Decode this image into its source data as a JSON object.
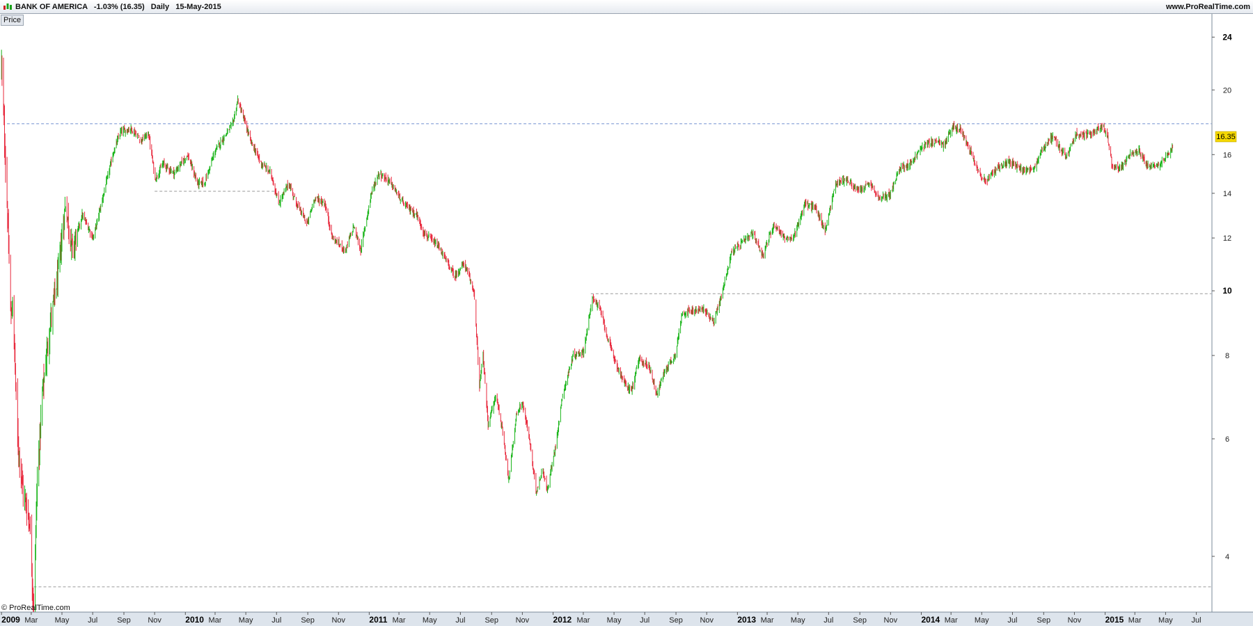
{
  "header": {
    "instrument": "BANK OF AMERICA",
    "change": "-1.03% (16.35)",
    "period": "Daily",
    "date": "15-May-2015",
    "website": "www.ProRealTime.com"
  },
  "panel_label": "Price",
  "copyright": "© ProRealTime.com",
  "chart_data": {
    "type": "candlestick",
    "scale": "log",
    "ylim": [
      3.3,
      26
    ],
    "xlim": [
      "2008-12-29",
      "2015-08-01"
    ],
    "last_price": 16.35,
    "last_price_label": "16.35",
    "colors": {
      "up": "#18b418",
      "down": "#e8283c",
      "last_price_bg": "#f5d800",
      "resistance": "#6f8fcf",
      "support": "#9a9a9a"
    },
    "y_ticks": [
      {
        "value": 24,
        "label": "24",
        "bold": true
      },
      {
        "value": 20,
        "label": "20",
        "bold": false
      },
      {
        "value": 16,
        "label": "16",
        "bold": false
      },
      {
        "value": 14,
        "label": "14",
        "bold": false
      },
      {
        "value": 12,
        "label": "12",
        "bold": false
      },
      {
        "value": 10,
        "label": "10",
        "bold": true
      },
      {
        "value": 8,
        "label": "8",
        "bold": false
      },
      {
        "value": 6,
        "label": "6",
        "bold": false
      },
      {
        "value": 4,
        "label": "4",
        "bold": false
      }
    ],
    "x_ticks": [
      {
        "date": "2009-01-01",
        "label": "2009",
        "year": true
      },
      {
        "date": "2009-03-01",
        "label": "Mar",
        "year": false
      },
      {
        "date": "2009-05-01",
        "label": "May",
        "year": false
      },
      {
        "date": "2009-07-01",
        "label": "Jul",
        "year": false
      },
      {
        "date": "2009-09-01",
        "label": "Sep",
        "year": false
      },
      {
        "date": "2009-11-01",
        "label": "Nov",
        "year": false
      },
      {
        "date": "2010-01-01",
        "label": "2010",
        "year": true
      },
      {
        "date": "2010-03-01",
        "label": "Mar",
        "year": false
      },
      {
        "date": "2010-05-01",
        "label": "May",
        "year": false
      },
      {
        "date": "2010-07-01",
        "label": "Jul",
        "year": false
      },
      {
        "date": "2010-09-01",
        "label": "Sep",
        "year": false
      },
      {
        "date": "2010-11-01",
        "label": "Nov",
        "year": false
      },
      {
        "date": "2011-01-01",
        "label": "2011",
        "year": true
      },
      {
        "date": "2011-03-01",
        "label": "Mar",
        "year": false
      },
      {
        "date": "2011-05-01",
        "label": "May",
        "year": false
      },
      {
        "date": "2011-07-01",
        "label": "Jul",
        "year": false
      },
      {
        "date": "2011-09-01",
        "label": "Sep",
        "year": false
      },
      {
        "date": "2011-11-01",
        "label": "Nov",
        "year": false
      },
      {
        "date": "2012-01-01",
        "label": "2012",
        "year": true
      },
      {
        "date": "2012-03-01",
        "label": "Mar",
        "year": false
      },
      {
        "date": "2012-05-01",
        "label": "May",
        "year": false
      },
      {
        "date": "2012-07-01",
        "label": "Jul",
        "year": false
      },
      {
        "date": "2012-09-01",
        "label": "Sep",
        "year": false
      },
      {
        "date": "2012-11-01",
        "label": "Nov",
        "year": false
      },
      {
        "date": "2013-01-01",
        "label": "2013",
        "year": true
      },
      {
        "date": "2013-03-01",
        "label": "Mar",
        "year": false
      },
      {
        "date": "2013-05-01",
        "label": "May",
        "year": false
      },
      {
        "date": "2013-07-01",
        "label": "Jul",
        "year": false
      },
      {
        "date": "2013-09-01",
        "label": "Sep",
        "year": false
      },
      {
        "date": "2013-11-01",
        "label": "Nov",
        "year": false
      },
      {
        "date": "2014-01-01",
        "label": "2014",
        "year": true
      },
      {
        "date": "2014-03-01",
        "label": "Mar",
        "year": false
      },
      {
        "date": "2014-05-01",
        "label": "May",
        "year": false
      },
      {
        "date": "2014-07-01",
        "label": "Jul",
        "year": false
      },
      {
        "date": "2014-09-01",
        "label": "Sep",
        "year": false
      },
      {
        "date": "2014-11-01",
        "label": "Nov",
        "year": false
      },
      {
        "date": "2015-01-01",
        "label": "2015",
        "year": true
      },
      {
        "date": "2015-03-01",
        "label": "Mar",
        "year": false
      },
      {
        "date": "2015-05-01",
        "label": "May",
        "year": false
      },
      {
        "date": "2015-07-01",
        "label": "Jul",
        "year": false
      }
    ],
    "hlines": [
      {
        "value": 17.8,
        "from": "2009-01-12",
        "to": "2015-07-31",
        "color": "#6f8fcf"
      },
      {
        "value": 14.1,
        "from": "2009-11-01",
        "to": "2010-07-01",
        "color": "#9a9a9a"
      },
      {
        "value": 9.9,
        "from": "2012-03-16",
        "to": "2015-07-31",
        "color": "#9a9a9a"
      },
      {
        "value": 3.6,
        "from": "2009-03-06",
        "to": "2015-07-31",
        "color": "#9a9a9a"
      }
    ],
    "series": [
      {
        "name": "BANK OF AMERICA",
        "close_path": [
          [
            "2009-01-01",
            22.0
          ],
          [
            "2009-01-12",
            13.5
          ],
          [
            "2009-01-20",
            9.0
          ],
          [
            "2009-01-23",
            9.7
          ],
          [
            "2009-02-02",
            6.0
          ],
          [
            "2009-02-13",
            5.0
          ],
          [
            "2009-02-26",
            4.5
          ],
          [
            "2009-03-06",
            3.3
          ],
          [
            "2009-03-12",
            5.0
          ],
          [
            "2009-03-23",
            7.0
          ],
          [
            "2009-04-08",
            9.0
          ],
          [
            "2009-04-23",
            10.5
          ],
          [
            "2009-05-08",
            13.5
          ],
          [
            "2009-05-22",
            11.5
          ],
          [
            "2009-06-10",
            13.0
          ],
          [
            "2009-07-02",
            12.0
          ],
          [
            "2009-07-23",
            14.0
          ],
          [
            "2009-08-10",
            16.0
          ],
          [
            "2009-08-25",
            17.3
          ],
          [
            "2009-09-15",
            17.5
          ],
          [
            "2009-10-05",
            16.8
          ],
          [
            "2009-10-20",
            17.2
          ],
          [
            "2009-11-02",
            14.7
          ],
          [
            "2009-11-18",
            15.5
          ],
          [
            "2009-12-10",
            15.0
          ],
          [
            "2010-01-05",
            16.0
          ],
          [
            "2010-01-25",
            14.5
          ],
          [
            "2010-02-08",
            14.5
          ],
          [
            "2010-03-01",
            16.2
          ],
          [
            "2010-04-05",
            17.8
          ],
          [
            "2010-04-15",
            19.3
          ],
          [
            "2010-04-30",
            17.8
          ],
          [
            "2010-05-10",
            16.8
          ],
          [
            "2010-06-01",
            15.5
          ],
          [
            "2010-06-20",
            15.0
          ],
          [
            "2010-07-05",
            13.5
          ],
          [
            "2010-07-25",
            14.5
          ],
          [
            "2010-08-10",
            13.5
          ],
          [
            "2010-08-31",
            12.6
          ],
          [
            "2010-09-15",
            13.8
          ],
          [
            "2010-10-05",
            13.5
          ],
          [
            "2010-10-20",
            12.0
          ],
          [
            "2010-11-15",
            11.5
          ],
          [
            "2010-12-01",
            12.5
          ],
          [
            "2010-12-15",
            11.5
          ],
          [
            "2011-01-05",
            14.0
          ],
          [
            "2011-01-20",
            15.0
          ],
          [
            "2011-02-10",
            14.6
          ],
          [
            "2011-03-10",
            13.5
          ],
          [
            "2011-04-05",
            13.0
          ],
          [
            "2011-04-20",
            12.2
          ],
          [
            "2011-05-20",
            11.6
          ],
          [
            "2011-06-20",
            10.5
          ],
          [
            "2011-07-08",
            11.0
          ],
          [
            "2011-07-28",
            10.0
          ],
          [
            "2011-08-08",
            7.2
          ],
          [
            "2011-08-15",
            8.0
          ],
          [
            "2011-08-25",
            6.3
          ],
          [
            "2011-09-10",
            7.0
          ],
          [
            "2011-09-25",
            6.0
          ],
          [
            "2011-10-05",
            5.2
          ],
          [
            "2011-10-20",
            6.5
          ],
          [
            "2011-11-01",
            6.8
          ],
          [
            "2011-11-15",
            6.0
          ],
          [
            "2011-11-28",
            5.0
          ],
          [
            "2011-12-12",
            5.4
          ],
          [
            "2011-12-20",
            5.0
          ],
          [
            "2012-01-05",
            5.8
          ],
          [
            "2012-01-20",
            7.0
          ],
          [
            "2012-02-10",
            8.0
          ],
          [
            "2012-03-01",
            8.1
          ],
          [
            "2012-03-20",
            9.8
          ],
          [
            "2012-04-05",
            9.3
          ],
          [
            "2012-04-20",
            8.4
          ],
          [
            "2012-05-10",
            7.6
          ],
          [
            "2012-05-25",
            7.2
          ],
          [
            "2012-06-05",
            7.1
          ],
          [
            "2012-06-20",
            7.9
          ],
          [
            "2012-07-10",
            7.7
          ],
          [
            "2012-07-25",
            7.0
          ],
          [
            "2012-08-10",
            7.6
          ],
          [
            "2012-08-30",
            8.0
          ],
          [
            "2012-09-14",
            9.3
          ],
          [
            "2012-10-05",
            9.3
          ],
          [
            "2012-10-25",
            9.4
          ],
          [
            "2012-11-15",
            9.0
          ],
          [
            "2012-11-30",
            9.8
          ],
          [
            "2012-12-20",
            11.4
          ],
          [
            "2013-01-10",
            11.8
          ],
          [
            "2013-02-01",
            12.2
          ],
          [
            "2013-02-20",
            11.3
          ],
          [
            "2013-03-15",
            12.6
          ],
          [
            "2013-04-05",
            12.0
          ],
          [
            "2013-04-20",
            11.9
          ],
          [
            "2013-05-15",
            13.5
          ],
          [
            "2013-06-05",
            13.3
          ],
          [
            "2013-06-24",
            12.3
          ],
          [
            "2013-07-15",
            14.5
          ],
          [
            "2013-08-05",
            14.7
          ],
          [
            "2013-08-30",
            14.1
          ],
          [
            "2013-09-20",
            14.5
          ],
          [
            "2013-10-10",
            13.7
          ],
          [
            "2013-11-01",
            14.0
          ],
          [
            "2013-11-20",
            15.3
          ],
          [
            "2013-12-10",
            15.5
          ],
          [
            "2014-01-05",
            16.5
          ],
          [
            "2014-01-30",
            16.8
          ],
          [
            "2014-02-15",
            16.5
          ],
          [
            "2014-03-05",
            17.6
          ],
          [
            "2014-03-20",
            17.4
          ],
          [
            "2014-04-05",
            16.5
          ],
          [
            "2014-04-28",
            14.9
          ],
          [
            "2014-05-10",
            14.6
          ],
          [
            "2014-06-01",
            15.3
          ],
          [
            "2014-06-25",
            15.6
          ],
          [
            "2014-07-20",
            15.2
          ],
          [
            "2014-08-10",
            15.1
          ],
          [
            "2014-09-01",
            16.4
          ],
          [
            "2014-09-20",
            17.1
          ],
          [
            "2014-10-15",
            15.8
          ],
          [
            "2014-11-05",
            17.2
          ],
          [
            "2014-12-01",
            17.1
          ],
          [
            "2014-12-25",
            17.7
          ],
          [
            "2015-01-05",
            17.1
          ],
          [
            "2015-01-15",
            15.4
          ],
          [
            "2015-01-30",
            15.2
          ],
          [
            "2015-02-20",
            16.0
          ],
          [
            "2015-03-10",
            16.2
          ],
          [
            "2015-03-25",
            15.4
          ],
          [
            "2015-04-20",
            15.5
          ],
          [
            "2015-05-15",
            16.35
          ]
        ]
      }
    ]
  }
}
